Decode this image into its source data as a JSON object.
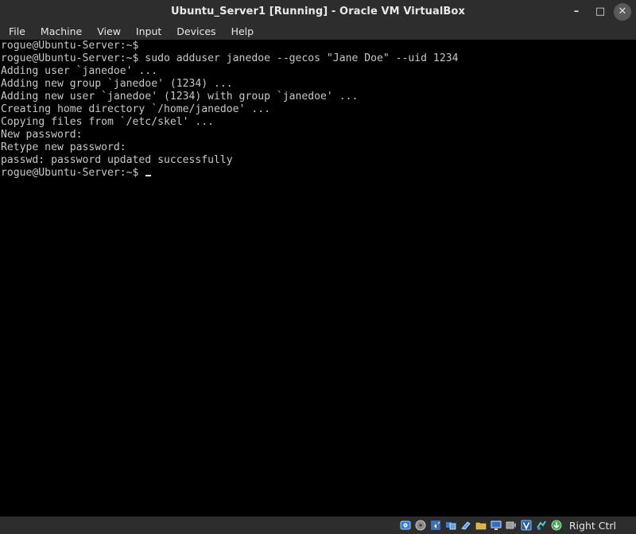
{
  "window": {
    "title": "Ubuntu_Server1 [Running] - Oracle VM VirtualBox",
    "controls": {
      "minimize_glyph": "–",
      "maximize_glyph": "□",
      "close_glyph": "✕"
    }
  },
  "menubar": {
    "items": [
      "File",
      "Machine",
      "View",
      "Input",
      "Devices",
      "Help"
    ]
  },
  "terminal": {
    "lines": [
      "rogue@Ubuntu-Server:~$",
      "rogue@Ubuntu-Server:~$ sudo adduser janedoe --gecos \"Jane Doe\" --uid 1234",
      "Adding user `janedoe' ...",
      "Adding new group `janedoe' (1234) ...",
      "Adding new user `janedoe' (1234) with group `janedoe' ...",
      "Creating home directory `/home/janedoe' ...",
      "Copying files from `/etc/skel' ...",
      "New password:",
      "Retype new password:",
      "passwd: password updated successfully",
      "rogue@Ubuntu-Server:~$ "
    ],
    "colors": {
      "background": "#000000",
      "foreground": "#c8c8c8"
    }
  },
  "statusbar": {
    "icons": [
      "hard-disk-icon",
      "optical-drive-icon",
      "audio-icon",
      "network-icon",
      "usb-icon",
      "shared-folders-icon",
      "display-icon",
      "video-capture-icon",
      "virtualization-icon",
      "mouse-integration-icon",
      "keyboard-capture-icon"
    ],
    "host_key": "Right Ctrl"
  }
}
